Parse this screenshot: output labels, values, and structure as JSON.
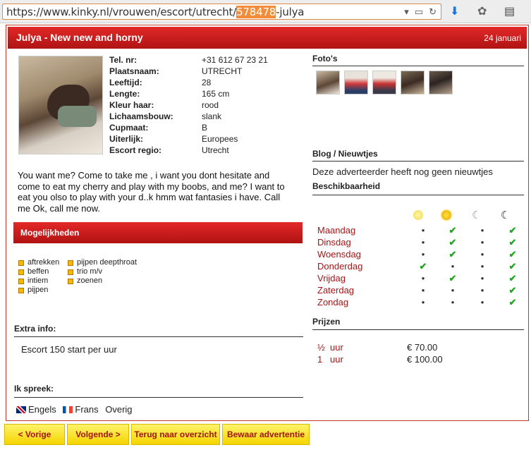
{
  "browser": {
    "url_prefix": "https://www.kinky.nl/vrouwen/escort/utrecht/",
    "url_highlight": "578478",
    "url_suffix": "-julya"
  },
  "ad": {
    "title": "Julya - New new and horny",
    "date": "24 januari"
  },
  "profile": [
    {
      "label": "Tel. nr:",
      "value": "+31 612 67 23 21"
    },
    {
      "label": "Plaatsnaam:",
      "value": "UTRECHT"
    },
    {
      "label": "Leeftijd:",
      "value": "28"
    },
    {
      "label": "Lengte:",
      "value": "165 cm"
    },
    {
      "label": "Kleur haar:",
      "value": "rood"
    },
    {
      "label": "Lichaamsbouw:",
      "value": "slank"
    },
    {
      "label": "Cupmaat:",
      "value": "B"
    },
    {
      "label": "Uiterlijk:",
      "value": "Europees"
    },
    {
      "label": "Escort regio:",
      "value": "Utrecht"
    }
  ],
  "description": "You want me? Come to take me , i want you dont hesitate and come to eat my cherry and play with my boobs, and me? I want to eat you olso to play with your d..k hmm wat fantasies i have. Call me Ok, call me now.",
  "options_title": "Mogelijkheden",
  "options_col1": [
    "aftrekken",
    "beffen",
    "intiem",
    "pijpen"
  ],
  "options_col2": [
    "pijpen deepthroat",
    "trio m/v",
    "zoenen"
  ],
  "extra_title": "Extra info:",
  "extra_text": "Escort 150 start per uur",
  "lang_title": "Ik spreek:",
  "languages": [
    "Engels",
    "Frans",
    "Overig"
  ],
  "photos_title": "Foto's",
  "blog_title": "Blog / Nieuwtjes",
  "blog_text": "Deze adverteerder heeft nog geen nieuwtjes",
  "avail_title": "Beschikbaarheid",
  "availability": [
    {
      "day": "Maandag",
      "slots": [
        false,
        true,
        false,
        true
      ]
    },
    {
      "day": "Dinsdag",
      "slots": [
        false,
        true,
        false,
        true
      ]
    },
    {
      "day": "Woensdag",
      "slots": [
        false,
        true,
        false,
        true
      ]
    },
    {
      "day": "Donderdag",
      "slots": [
        true,
        false,
        false,
        true
      ]
    },
    {
      "day": "Vrijdag",
      "slots": [
        false,
        true,
        false,
        true
      ]
    },
    {
      "day": "Zaterdag",
      "slots": [
        false,
        false,
        false,
        true
      ]
    },
    {
      "day": "Zondag",
      "slots": [
        false,
        false,
        false,
        true
      ]
    }
  ],
  "prices_title": "Prijzen",
  "prices": [
    {
      "qty": "½",
      "unit": "uur",
      "price": "€ 70.00"
    },
    {
      "qty": "1",
      "unit": "uur",
      "price": "€ 100.00"
    }
  ],
  "buttons": {
    "prev": "< Vorige",
    "next": "Volgende >",
    "back": "Terug naar overzicht",
    "save": "Bewaar advertentie"
  },
  "colors": {
    "accent": "#c81e1e",
    "button": "#f7dc2b",
    "check": "#22a622"
  }
}
